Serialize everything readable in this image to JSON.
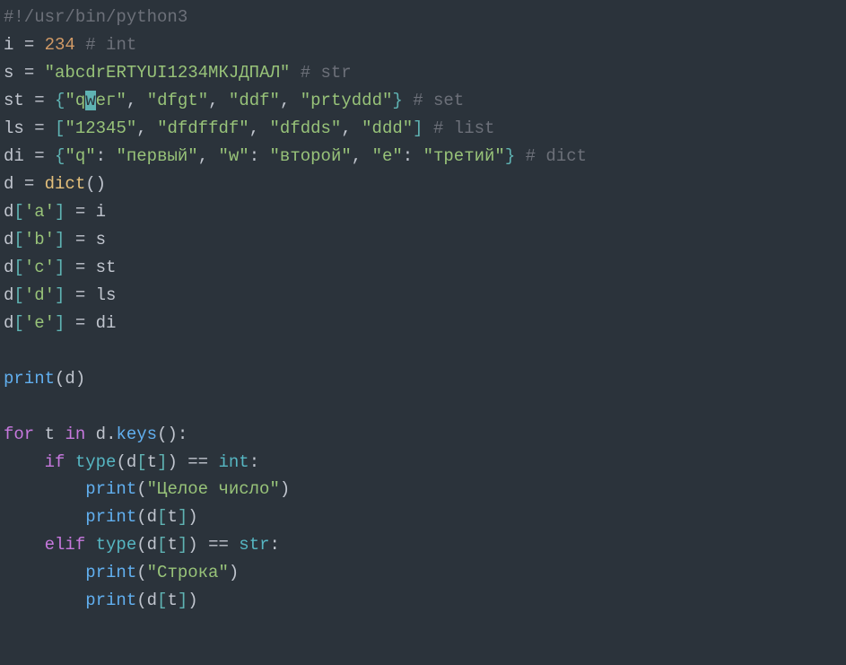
{
  "code": {
    "line1": {
      "shebang": "#!/usr/bin/python3"
    },
    "line2": {
      "var": "i",
      "op": "=",
      "num": "234",
      "comment": "# int"
    },
    "line3": {
      "var": "s",
      "op": "=",
      "str": "\"abcdrERTYUI1234МКЈДПАЛ\"",
      "comment": "# str"
    },
    "line4": {
      "var": "st",
      "op": "=",
      "lb": "{",
      "s1a": "\"q",
      "cur": "w",
      "s1b": "ег\"",
      "s2": "\"dfgt\"",
      "s3": "\"ddf\"",
      "s4": "\"prtyddd\"",
      "rb": "}",
      "comment": "# set"
    },
    "line5": {
      "var": "ls",
      "op": "=",
      "lb": "[",
      "s1": "\"12345\"",
      "s2": "\"dfdffdf\"",
      "s3": "\"dfdds\"",
      "s4": "\"ddd\"",
      "rb": "]",
      "comment": "# list"
    },
    "line6": {
      "var": "di",
      "op": "=",
      "lb": "{",
      "k1": "\"q\"",
      "v1": "\"первый\"",
      "k2": "\"w\"",
      "v2": "\"второй\"",
      "k3": "\"e\"",
      "v3": "\"третий\"",
      "rb": "}",
      "comment": "# dict"
    },
    "line7": {
      "var": "d",
      "op": "=",
      "fn": "dict",
      "lp": "(",
      "rp": ")"
    },
    "line8": {
      "var": "d",
      "lb": "[",
      "key": "'a'",
      "rb": "]",
      "op": "=",
      "rhs": "i"
    },
    "line9": {
      "var": "d",
      "lb": "[",
      "key": "'b'",
      "rb": "]",
      "op": "=",
      "rhs": "s"
    },
    "line10": {
      "var": "d",
      "lb": "[",
      "key": "'c'",
      "rb": "]",
      "op": "=",
      "rhs": "st"
    },
    "line11": {
      "var": "d",
      "lb": "[",
      "key": "'d'",
      "rb": "]",
      "op": "=",
      "rhs": "ls"
    },
    "line12": {
      "var": "d",
      "lb": "[",
      "key": "'e'",
      "rb": "]",
      "op": "=",
      "rhs": "di"
    },
    "line14": {
      "fn": "print",
      "lp": "(",
      "arg": "d",
      "rp": ")"
    },
    "line16": {
      "for": "for",
      "t": "t",
      "in": "in",
      "d": "d",
      "dot": ".",
      "keys": "keys",
      "lp": "(",
      "rp": ")",
      "colon": ":"
    },
    "line17": {
      "if": "if",
      "type": "type",
      "lp": "(",
      "d": "d",
      "lb": "[",
      "t": "t",
      "rb": "]",
      "rp": ")",
      "eq": "==",
      "int": "int",
      "colon": ":"
    },
    "line18": {
      "fn": "print",
      "lp": "(",
      "str": "\"Целое число\"",
      "rp": ")"
    },
    "line19": {
      "fn": "print",
      "lp": "(",
      "d": "d",
      "lb": "[",
      "t": "t",
      "rb": "]",
      "rp": ")"
    },
    "line20": {
      "elif": "elif",
      "type": "type",
      "lp": "(",
      "d": "d",
      "lb": "[",
      "t": "t",
      "rb": "]",
      "rp": ")",
      "eq": "==",
      "str": "str",
      "colon": ":"
    },
    "line21": {
      "fn": "print",
      "lp": "(",
      "s": "\"Строка\"",
      "rp": ")"
    },
    "line22": {
      "fn": "print",
      "lp": "(",
      "d": "d",
      "lb": "[",
      "t": "t",
      "rb": "]",
      "rp": ")"
    }
  }
}
